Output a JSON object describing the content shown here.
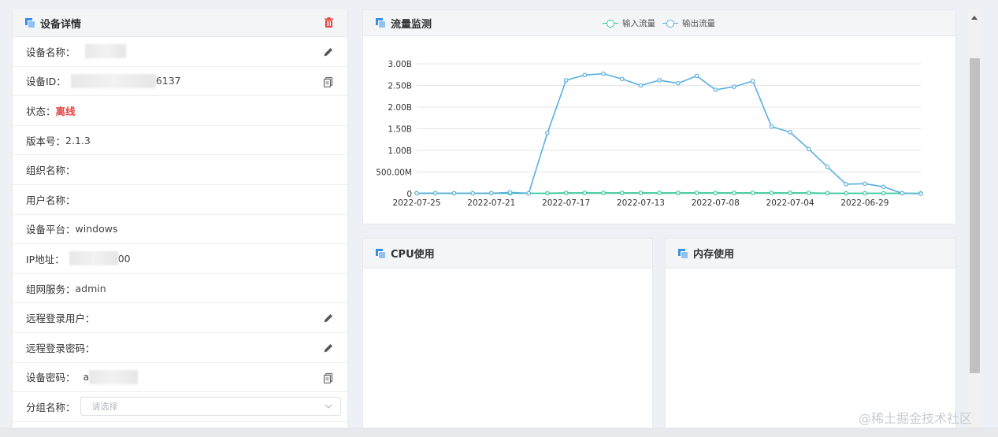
{
  "device": {
    "title": "设备详情",
    "rows": [
      {
        "label": "设备名称：",
        "value": "",
        "action": "pencil-icon"
      },
      {
        "label": "设备ID：",
        "value": "6137",
        "action": "copy-icon"
      },
      {
        "label": "状态：",
        "value": "离线",
        "action": ""
      },
      {
        "label": "版本号：",
        "value": "2.1.3",
        "action": ""
      },
      {
        "label": "组织名称：",
        "value": "",
        "action": ""
      },
      {
        "label": "用户名称：",
        "value": "",
        "action": ""
      },
      {
        "label": "设备平台：",
        "value": "windows",
        "action": ""
      },
      {
        "label": "IP地址：",
        "value": "00",
        "action": ""
      },
      {
        "label": "组网服务：",
        "value": "admin",
        "action": ""
      },
      {
        "label": "远程登录用户：",
        "value": "",
        "action": "pencil-icon"
      },
      {
        "label": "远程登录密码：",
        "value": "",
        "action": "pencil-icon"
      },
      {
        "label": "设备密码：",
        "value": "a",
        "action": "copy-icon"
      }
    ],
    "group": {
      "label": "分组名称：",
      "placeholder": "请选择"
    }
  },
  "traffic": {
    "title": "流量监测",
    "legend": [
      "输入流量",
      "输出流量"
    ]
  },
  "cpu": {
    "title": "CPU使用"
  },
  "memory": {
    "title": "内存使用"
  },
  "watermark": "@稀土掘金技术社区",
  "colors": {
    "accent": "#3a8ee6",
    "input_series": "#2ecb9a",
    "output_series": "#5aafe0",
    "offline": "#e64242"
  },
  "chart_data": {
    "type": "line",
    "ylim": [
      0,
      3.0
    ],
    "y_unit": "GB",
    "yticks": [
      "0",
      "500.00M",
      "1.00B",
      "1.50B",
      "2.00B",
      "2.50B",
      "3.00B"
    ],
    "x_tick_labels": [
      "2022-07-25",
      "2022-07-21",
      "2022-07-17",
      "2022-07-13",
      "2022-07-08",
      "2022-07-04",
      "2022-06-29"
    ],
    "series": [
      {
        "name": "输入流量",
        "values": [
          0.01,
          0.01,
          0.01,
          0.01,
          0.01,
          0.01,
          0.01,
          0.01,
          0.02,
          0.02,
          0.02,
          0.02,
          0.02,
          0.02,
          0.02,
          0.02,
          0.02,
          0.02,
          0.02,
          0.02,
          0.02,
          0.02,
          0.01,
          0.01,
          0.01,
          0.01,
          0.01,
          0.01
        ]
      },
      {
        "name": "输出流量",
        "values": [
          0.01,
          0.01,
          0.01,
          0.01,
          0.01,
          0.03,
          0.01,
          1.4,
          2.62,
          2.74,
          2.77,
          2.65,
          2.5,
          2.62,
          2.55,
          2.72,
          2.4,
          2.47,
          2.6,
          1.55,
          1.42,
          1.03,
          0.62,
          0.22,
          0.23,
          0.16,
          0.01,
          0.0
        ]
      }
    ]
  }
}
